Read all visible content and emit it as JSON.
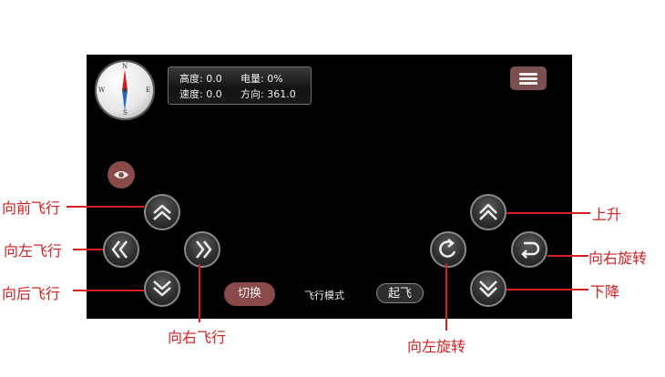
{
  "compass": {
    "n": "N",
    "e": "E",
    "s": "S",
    "w": "W"
  },
  "status": {
    "altitude": "高度: 0.0",
    "battery": "电量: 0%",
    "speed": "速度: 0.0",
    "heading": "方向: 361.0"
  },
  "buttons": {
    "switch": "切换",
    "mode": "飞行模式",
    "takeoff": "起飞"
  },
  "annotations": {
    "forward": "向前飞行",
    "left": "向左飞行",
    "backward": "向后飞行",
    "right": "向右飞行",
    "up": "上升",
    "rotate_right": "向右旋转",
    "down": "下降",
    "rotate_left": "向左旋转"
  },
  "icons": [
    "compass-icon",
    "menu-icon",
    "eye-icon",
    "chevron-up-icon",
    "chevron-left-icon",
    "chevron-right-icon",
    "chevron-down-icon",
    "double-chevron-up-icon",
    "double-chevron-down-icon",
    "rotate-left-icon",
    "rotate-right-icon"
  ],
  "colors": {
    "screen": "#000000",
    "accent": "#8a4a4a",
    "annotation": "#d42020"
  }
}
